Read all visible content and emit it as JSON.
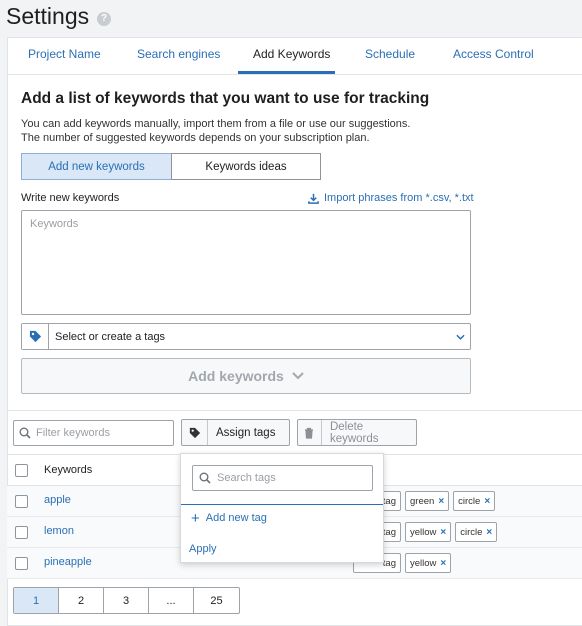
{
  "page": {
    "title": "Settings",
    "help_icon": "question-circle-icon"
  },
  "tabs": [
    {
      "label": "Project Name",
      "active": false
    },
    {
      "label": "Search engines",
      "active": false
    },
    {
      "label": "Add Keywords",
      "active": true
    },
    {
      "label": "Schedule",
      "active": false
    },
    {
      "label": "Access Control",
      "active": false
    }
  ],
  "main": {
    "heading": "Add a list of keywords that you want to use for tracking",
    "desc_line1": "You can add keywords manually, import them from a file or use our suggestions.",
    "desc_line2": "The number of suggested keywords depends on your subscription plan.",
    "toggle": {
      "option_new": "Add new keywords",
      "option_ideas": "Keywords ideas",
      "selected": "Add new keywords"
    },
    "write_label": "Write new keywords",
    "import_label": "Import phrases from *.csv, *.txt",
    "keywords_placeholder": "Keywords",
    "tag_select_placeholder": "Select or create a tags",
    "add_button": "Add keywords"
  },
  "toolbar": {
    "filter_placeholder": "Filter keywords",
    "assign_tags": "Assign tags",
    "delete_keywords": "Delete keywords"
  },
  "table": {
    "column_keywords": "Keywords",
    "rows": [
      {
        "keyword": "apple",
        "tags": [
          "tag",
          "green",
          "circle"
        ]
      },
      {
        "keyword": "lemon",
        "tags": [
          "tag",
          "yellow",
          "circle"
        ]
      },
      {
        "keyword": "pineapple",
        "tags": [
          "tag",
          "yellow"
        ]
      }
    ]
  },
  "tag_popup": {
    "search_placeholder": "Search tags",
    "add_new_tag": "Add new tag",
    "apply": "Apply"
  },
  "pagination": {
    "pages": [
      "1",
      "2",
      "3",
      "...",
      "25"
    ],
    "current": "1"
  },
  "colors": {
    "accent": "#2a6fb5",
    "selected_bg": "#d9e7f6"
  }
}
